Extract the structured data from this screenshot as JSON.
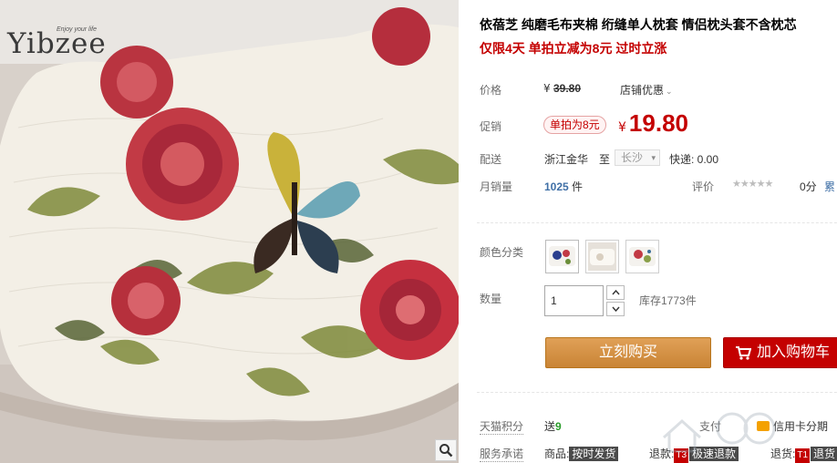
{
  "gallery": {
    "brand": "Yibzee",
    "brand_tagline": "Enjoy your life",
    "zoom_icon": "magnifier-icon"
  },
  "product": {
    "title": "依蓓芝 纯磨毛布夹棉 绗缝单人枕套 情侣枕头套不含枕芯",
    "promo_line": "仅限4天 单拍立减为8元 过时立涨"
  },
  "price": {
    "label": "价格",
    "currency": "¥",
    "original": "39.80",
    "shop_discount": "店铺优惠",
    "promo_label": "促销",
    "promo_badge": "单拍为8元",
    "current": "19.80"
  },
  "delivery": {
    "label": "配送",
    "from": "浙江金华",
    "to_word": "至",
    "city": "长沙",
    "express": "快递: 0.00"
  },
  "sales": {
    "label": "月销量",
    "count": "1025",
    "unit": "件",
    "rating_label": "评价",
    "stars": "★★★★★",
    "score": "0分",
    "cumulative_prefix": "累"
  },
  "sku": {
    "label": "颜色分类",
    "options": [
      "pillow-variant-1",
      "pillow-variant-2",
      "pillow-variant-3"
    ]
  },
  "quantity": {
    "label": "数量",
    "value": "1",
    "stock": "库存1773件"
  },
  "actions": {
    "buy_now": "立刻购买",
    "add_cart": "加入购物车"
  },
  "services": {
    "points_label": "天猫积分",
    "points_prefix": "送",
    "points_value": "9",
    "pay_label": "支付",
    "credit_installment": "信用卡分期",
    "promise_label": "服务承诺",
    "goods_prefix": "商品:",
    "goods_tag": "按时发货",
    "refund_prefix": "退款:",
    "refund_code": "T3",
    "refund_tag": "极速退款",
    "return_prefix": "退货:",
    "return_code": "T1",
    "return_tag": "退货"
  },
  "colors": {
    "accent_red": "#c40000",
    "buy_orange": "#d08f46",
    "sales_blue": "#3f6fa6"
  }
}
